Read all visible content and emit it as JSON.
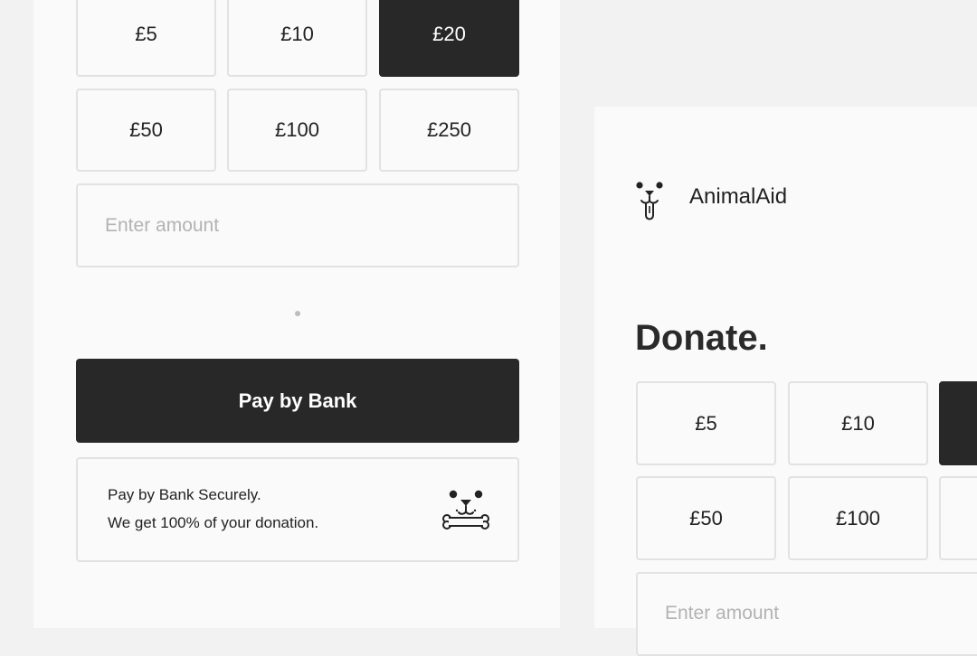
{
  "left_form": {
    "amounts": [
      {
        "label": "£5"
      },
      {
        "label": "£10"
      },
      {
        "label": "£20"
      },
      {
        "label": "£50"
      },
      {
        "label": "£100"
      },
      {
        "label": "£250"
      }
    ],
    "selected_amount": "£20",
    "custom_amount_placeholder": "Enter amount",
    "pay_button_label": "Pay by Bank",
    "secure_card": {
      "line1": "Pay by Bank Securely.",
      "line2": "We get 100% of your donation.",
      "icon": "dog-bone-icon"
    }
  },
  "right_form": {
    "brand": {
      "name": "AnimalAid",
      "icon": "dog-face-logo-icon"
    },
    "title": "Donate.",
    "amounts": [
      {
        "label": "£5"
      },
      {
        "label": "£10"
      },
      {
        "label": "£50"
      },
      {
        "label": "£100"
      }
    ],
    "custom_amount_placeholder": "Enter amount"
  },
  "colors": {
    "selected_bg": "#282828",
    "border": "#e2e2e2",
    "panel_bg": "#fafafa",
    "page_bg": "#f2f2f2"
  }
}
